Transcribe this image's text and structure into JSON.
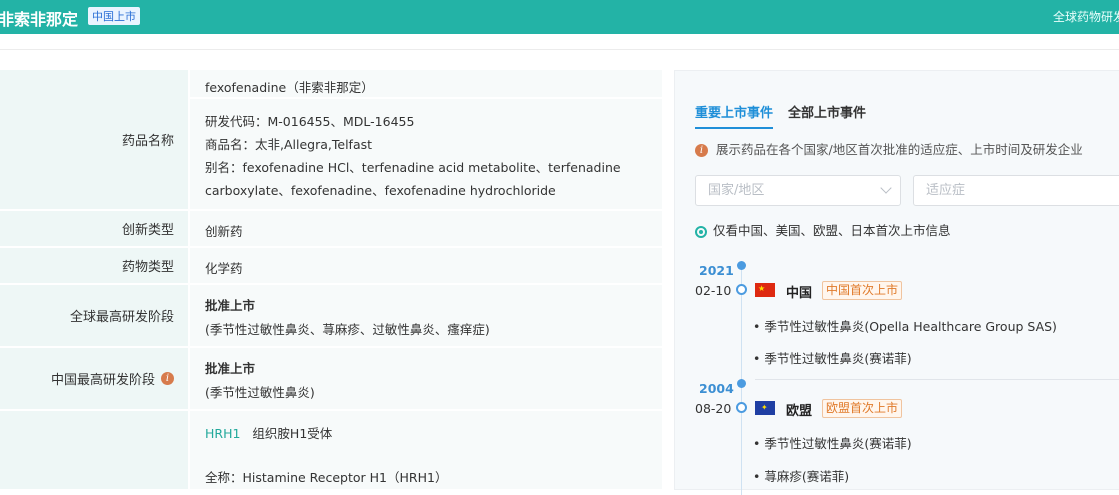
{
  "header": {
    "title": "非索非那定",
    "badge": "中国上市",
    "right_link": "全球药物研发"
  },
  "info_rows": {
    "drug_name": {
      "label": "药品名称",
      "name": "fexofenadine（非索非那定）",
      "code": "研发代码：M-016455、MDL-16455",
      "trade": "商品名：太非,Allegra,Telfast",
      "alias1": "别名：fexofenadine HCl、terfenadine acid metabolite、terfenadine",
      "alias2": "carboxylate、fexofenadine、fexofenadine hydrochloride"
    },
    "innovation": {
      "label": "创新类型",
      "value": "创新药"
    },
    "drug_type": {
      "label": "药物类型",
      "value": "化学药"
    },
    "global_stage": {
      "label": "全球最高研发阶段",
      "value": "批准上市",
      "detail": "(季节性过敏性鼻炎、荨麻疹、过敏性鼻炎、瘙痒症)"
    },
    "china_stage": {
      "label": "中国最高研发阶段",
      "value": "批准上市",
      "detail": "(季节性过敏性鼻炎)"
    },
    "target": {
      "code": "HRH1",
      "name": "组织胺H1受体",
      "fullname": "全称：Histamine Receptor H1（HRH1）"
    }
  },
  "panel": {
    "tabs": [
      "重要上市事件",
      "全部上市事件"
    ],
    "notice": "展示药品在各个国家/地区首次批准的适应症、上市时间及研发企业",
    "region_placeholder": "国家/地区",
    "indication_placeholder": "适应症",
    "radio_label": "仅看中国、美国、欧盟、日本首次上市信息",
    "events": [
      {
        "year": "2021",
        "date": "02-10",
        "country": "中国",
        "tag": "中国首次上市",
        "items": [
          "• 季节性过敏性鼻炎(Opella Healthcare Group SAS)",
          "• 季节性过敏性鼻炎(赛诺菲)"
        ]
      },
      {
        "year": "2004",
        "date": "08-20",
        "country": "欧盟",
        "tag": "欧盟首次上市",
        "items": [
          "• 季节性过敏性鼻炎(赛诺菲)",
          "• 荨麻疹(赛诺菲)"
        ]
      }
    ]
  }
}
